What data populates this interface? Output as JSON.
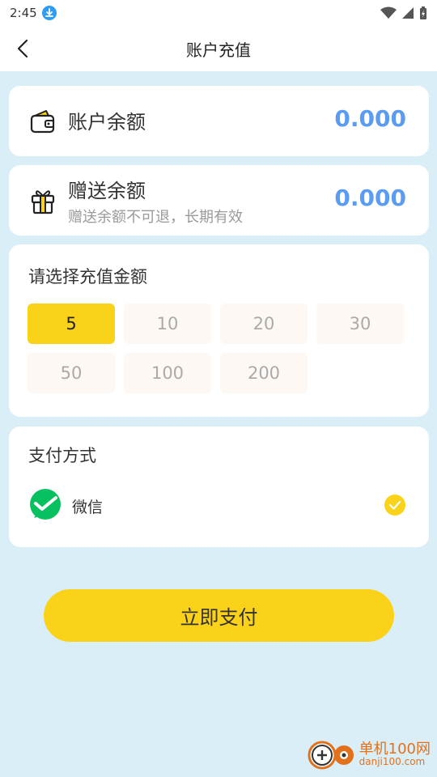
{
  "status_bar": {
    "time": "2:45",
    "icons": [
      "download-notification-icon",
      "wifi-icon",
      "signal-icon",
      "battery-icon"
    ]
  },
  "nav": {
    "title": "账户充值",
    "back_icon": "chevron-left-icon"
  },
  "balance": {
    "label": "账户余额",
    "value": "0.000",
    "icon": "wallet-icon"
  },
  "gift": {
    "label": "赠送余额",
    "note": "赠送余额不可退，长期有效",
    "value": "0.000",
    "icon": "gift-icon"
  },
  "amount": {
    "title": "请选择充值金额",
    "options": [
      "5",
      "10",
      "20",
      "30",
      "50",
      "100",
      "200"
    ],
    "selected": "5"
  },
  "payment": {
    "title": "支付方式",
    "methods": [
      {
        "label": "微信",
        "icon": "wechat-icon",
        "selected": true
      }
    ]
  },
  "pay_button": {
    "label": "立即支付"
  },
  "watermark": {
    "name": "单机100网",
    "domain": "danji100.com"
  },
  "colors": {
    "page_bg": "#d9eef7",
    "accent_yellow": "#fbd21a",
    "value_blue": "#5b9bf0",
    "wechat_green": "#07c160",
    "option_bg": "#fdf8f3"
  }
}
